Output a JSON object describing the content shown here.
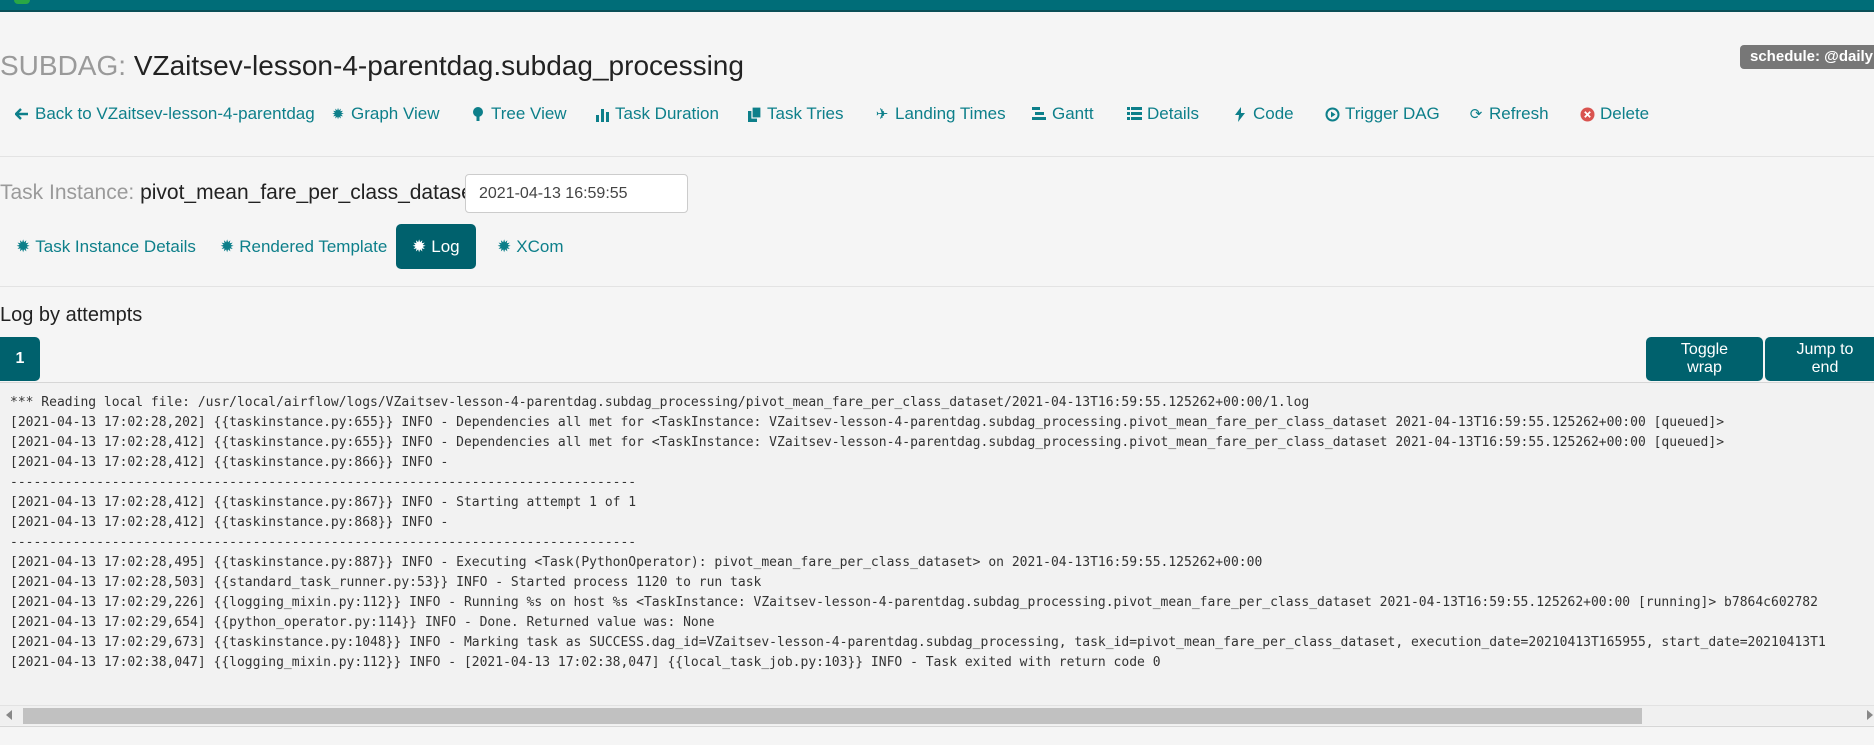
{
  "header": {
    "title_prefix": "SUBDAG:",
    "title": "VZaitsev-lesson-4-parentdag.subdag_processing",
    "schedule_badge": "schedule: @daily"
  },
  "dag_nav": {
    "items": [
      {
        "label": "Back to VZaitsev-lesson-4-parentdag",
        "icon": "arrow-left-icon"
      },
      {
        "label": "Graph View",
        "icon": "certificate-icon"
      },
      {
        "label": "Tree View",
        "icon": "tree-icon"
      },
      {
        "label": "Task Duration",
        "icon": "bar-chart-icon"
      },
      {
        "label": "Task Tries",
        "icon": "duplicate-icon"
      },
      {
        "label": "Landing Times",
        "icon": "plane-icon"
      },
      {
        "label": "Gantt",
        "icon": "gantt-icon"
      },
      {
        "label": "Details",
        "icon": "list-icon"
      },
      {
        "label": "Code",
        "icon": "flash-icon"
      },
      {
        "label": "Trigger DAG",
        "icon": "play-circle-icon"
      },
      {
        "label": "Refresh",
        "icon": "refresh-icon"
      },
      {
        "label": "Delete",
        "icon": "remove-circle-icon"
      }
    ]
  },
  "task_instance": {
    "prefix": "Task Instance:",
    "name": "pivot_mean_fare_per_class_dataset",
    "execution_date": "2021-04-13 16:59:55",
    "tabs": [
      {
        "label": "Task Instance Details",
        "active": false
      },
      {
        "label": "Rendered Template",
        "active": false
      },
      {
        "label": "Log",
        "active": true
      },
      {
        "label": "XCom",
        "active": false
      }
    ]
  },
  "log": {
    "heading": "Log by attempts",
    "attempt": "1",
    "toggle_wrap": "Toggle wrap",
    "jump_to_end": "Jump to end",
    "lines": [
      "*** Reading local file: /usr/local/airflow/logs/VZaitsev-lesson-4-parentdag.subdag_processing/pivot_mean_fare_per_class_dataset/2021-04-13T16:59:55.125262+00:00/1.log",
      "[2021-04-13 17:02:28,202] {{taskinstance.py:655}} INFO - Dependencies all met for <TaskInstance: VZaitsev-lesson-4-parentdag.subdag_processing.pivot_mean_fare_per_class_dataset 2021-04-13T16:59:55.125262+00:00 [queued]>",
      "[2021-04-13 17:02:28,412] {{taskinstance.py:655}} INFO - Dependencies all met for <TaskInstance: VZaitsev-lesson-4-parentdag.subdag_processing.pivot_mean_fare_per_class_dataset 2021-04-13T16:59:55.125262+00:00 [queued]>",
      "[2021-04-13 17:02:28,412] {{taskinstance.py:866}} INFO -",
      "--------------------------------------------------------------------------------",
      "[2021-04-13 17:02:28,412] {{taskinstance.py:867}} INFO - Starting attempt 1 of 1",
      "[2021-04-13 17:02:28,412] {{taskinstance.py:868}} INFO -",
      "--------------------------------------------------------------------------------",
      "[2021-04-13 17:02:28,495] {{taskinstance.py:887}} INFO - Executing <Task(PythonOperator): pivot_mean_fare_per_class_dataset> on 2021-04-13T16:59:55.125262+00:00",
      "[2021-04-13 17:02:28,503] {{standard_task_runner.py:53}} INFO - Started process 1120 to run task",
      "[2021-04-13 17:02:29,226] {{logging_mixin.py:112}} INFO - Running %s on host %s <TaskInstance: VZaitsev-lesson-4-parentdag.subdag_processing.pivot_mean_fare_per_class_dataset 2021-04-13T16:59:55.125262+00:00 [running]> b7864c602782",
      "[2021-04-13 17:02:29,654] {{python_operator.py:114}} INFO - Done. Returned value was: None",
      "[2021-04-13 17:02:29,673] {{taskinstance.py:1048}} INFO - Marking task as SUCCESS.dag_id=VZaitsev-lesson-4-parentdag.subdag_processing, task_id=pivot_mean_fare_per_class_dataset, execution_date=20210413T165955, start_date=20210413T1",
      "[2021-04-13 17:02:38,047] {{logging_mixin.py:112}} INFO - [2021-04-13 17:02:38,047] {{local_task_job.py:103}} INFO - Task exited with return code 0"
    ]
  }
}
